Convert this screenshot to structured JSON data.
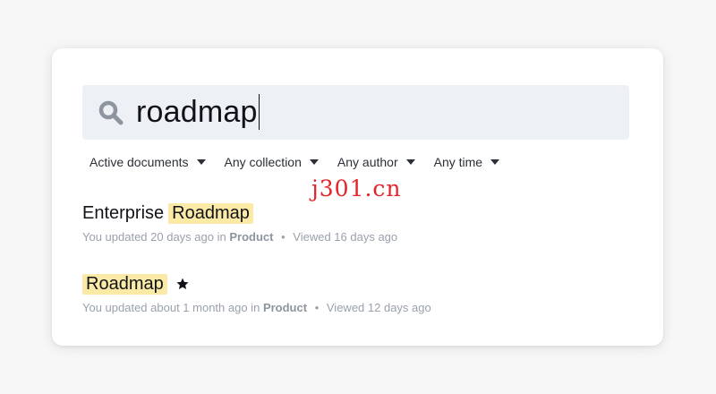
{
  "search": {
    "query": "roadmap"
  },
  "filters": [
    {
      "label": "Active documents"
    },
    {
      "label": "Any collection"
    },
    {
      "label": "Any author"
    },
    {
      "label": "Any time"
    }
  ],
  "watermark": "j301.cn",
  "results": [
    {
      "title_prefix": "Enterprise",
      "title_highlight": "Roadmap",
      "starred": false,
      "updated": "You updated 20 days ago in",
      "collection": "Product",
      "separator": "•",
      "viewed": "Viewed 16 days ago"
    },
    {
      "title_prefix": "",
      "title_highlight": "Roadmap",
      "starred": true,
      "updated": "You updated about 1 month ago in",
      "collection": "Product",
      "separator": "•",
      "viewed": "Viewed 12 days ago"
    }
  ]
}
